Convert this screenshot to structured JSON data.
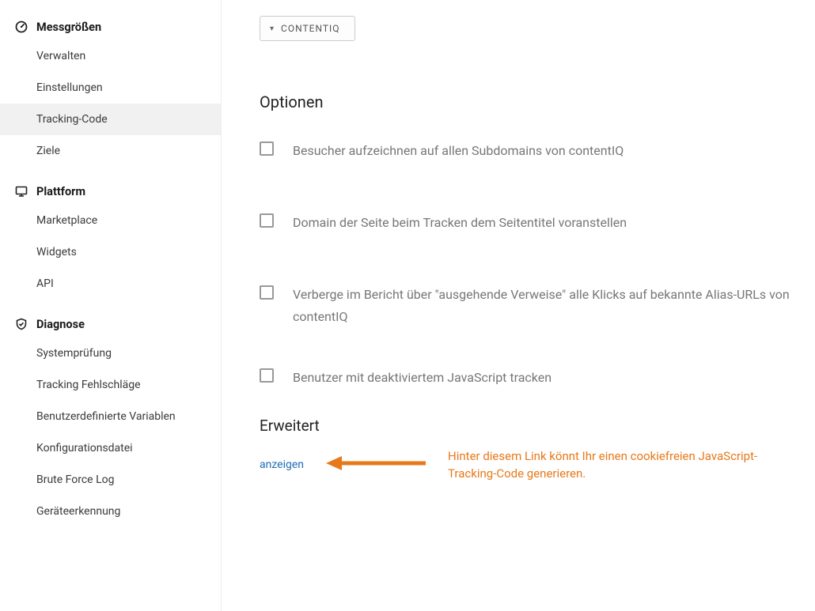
{
  "sidebar": {
    "sections": [
      {
        "title": "Messgrößen",
        "icon": "gauge-icon",
        "items": [
          {
            "label": "Verwalten",
            "active": false
          },
          {
            "label": "Einstellungen",
            "active": false
          },
          {
            "label": "Tracking-Code",
            "active": true
          },
          {
            "label": "Ziele",
            "active": false
          }
        ]
      },
      {
        "title": "Plattform",
        "icon": "monitor-icon",
        "items": [
          {
            "label": "Marketplace",
            "active": false
          },
          {
            "label": "Widgets",
            "active": false
          },
          {
            "label": "API",
            "active": false
          }
        ]
      },
      {
        "title": "Diagnose",
        "icon": "shield-icon",
        "items": [
          {
            "label": "Systemprüfung",
            "active": false
          },
          {
            "label": "Tracking Fehlschläge",
            "active": false
          },
          {
            "label": "Benutzerdefinierte Variablen",
            "active": false
          },
          {
            "label": "Konfigurationsdatei",
            "active": false
          },
          {
            "label": "Brute Force Log",
            "active": false
          },
          {
            "label": "Geräteerkennung",
            "active": false
          }
        ]
      }
    ]
  },
  "main": {
    "dropdown_label": "CONTENTIQ",
    "options_title": "Optionen",
    "options": [
      "Besucher aufzeichnen auf allen Subdomains von contentIQ",
      "Domain der Seite beim Tracken dem Seitentitel voranstellen",
      "Verberge im Bericht über \"ausgehende Verweise\" alle Klicks auf bekannte Alias-URLs von contentIQ",
      "Benutzer mit deaktiviertem JavaScript tracken"
    ],
    "advanced_title": "Erweitert",
    "show_link": "anzeigen",
    "annotation": "Hinter diesem Link könnt Ihr einen cookiefreien JavaScript-Tracking-Code generieren."
  }
}
